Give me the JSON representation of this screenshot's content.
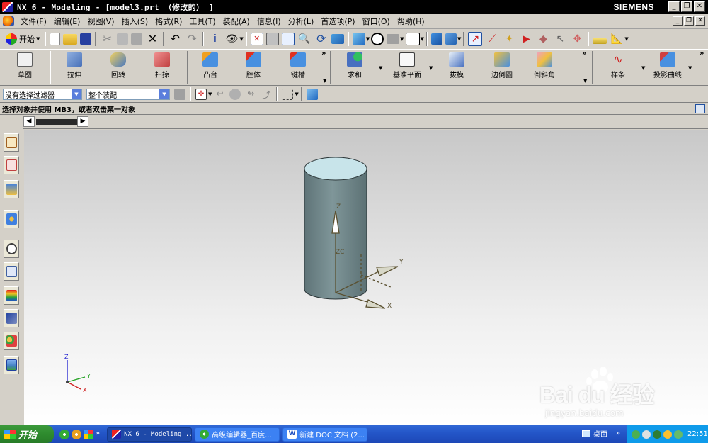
{
  "window": {
    "title": "NX 6 - Modeling - [model3.prt （修改的） ]",
    "brand": "SIEMENS",
    "buttons": {
      "minimize": "_",
      "restore": "❐",
      "close": "✕"
    }
  },
  "menu": {
    "items": [
      "文件(F)",
      "编辑(E)",
      "视图(V)",
      "插入(S)",
      "格式(R)",
      "工具(T)",
      "装配(A)",
      "信息(I)",
      "分析(L)",
      "首选项(P)",
      "窗口(O)",
      "帮助(H)"
    ]
  },
  "standard_toolbar": {
    "start_label": "开始"
  },
  "feature_toolbar": {
    "items": [
      {
        "label": "草图",
        "icon": "sketch-icon"
      },
      {
        "label": "拉伸",
        "icon": "extrude-icon"
      },
      {
        "label": "回转",
        "icon": "revolve-icon"
      },
      {
        "label": "扫掠",
        "icon": "sweep-icon"
      },
      {
        "label": "凸台",
        "icon": "boss-icon"
      },
      {
        "label": "腔体",
        "icon": "pocket-icon"
      },
      {
        "label": "键槽",
        "icon": "slot-icon"
      },
      {
        "label": "求和",
        "icon": "unite-icon"
      },
      {
        "label": "基准平面",
        "icon": "datum-plane-icon"
      },
      {
        "label": "拔模",
        "icon": "draft-icon"
      },
      {
        "label": "边倒圆",
        "icon": "edge-blend-icon"
      },
      {
        "label": "倒斜角",
        "icon": "chamfer-icon"
      },
      {
        "label": "样条",
        "icon": "spline-icon"
      },
      {
        "label": "投影曲线",
        "icon": "project-curve-icon"
      }
    ]
  },
  "selection_bar": {
    "filter_value": "没有选择过滤器",
    "scope_value": "整个装配"
  },
  "cue_line": {
    "text": "选择对象并使用 MB3，或者双击某一对象"
  },
  "graphics": {
    "triad_labels": {
      "z": "Z",
      "zc": "ZC",
      "y": "Y",
      "x": "X"
    },
    "view_triad": {
      "z": "Z",
      "y": "Y",
      "x": "X"
    }
  },
  "taskbar": {
    "start_label": "开始",
    "tasks": [
      {
        "label": "NX 6 - Modeling ...",
        "active": true
      },
      {
        "label": "高级编辑器_百度...",
        "active": false
      },
      {
        "label": "新建 DOC 文档 (2...",
        "active": false
      }
    ],
    "desktop_label": "桌面",
    "clock": "22:51"
  },
  "watermark": {
    "logo_text": "Bai du 经验",
    "url": "jingyan.baidu.com"
  },
  "colors": {
    "cylinder": "#6f8588",
    "cylinder_top": "#c8e4ea",
    "triad": "#5a5030",
    "view_z": "#2020d0",
    "view_y": "#20a020",
    "view_x": "#d02020"
  }
}
